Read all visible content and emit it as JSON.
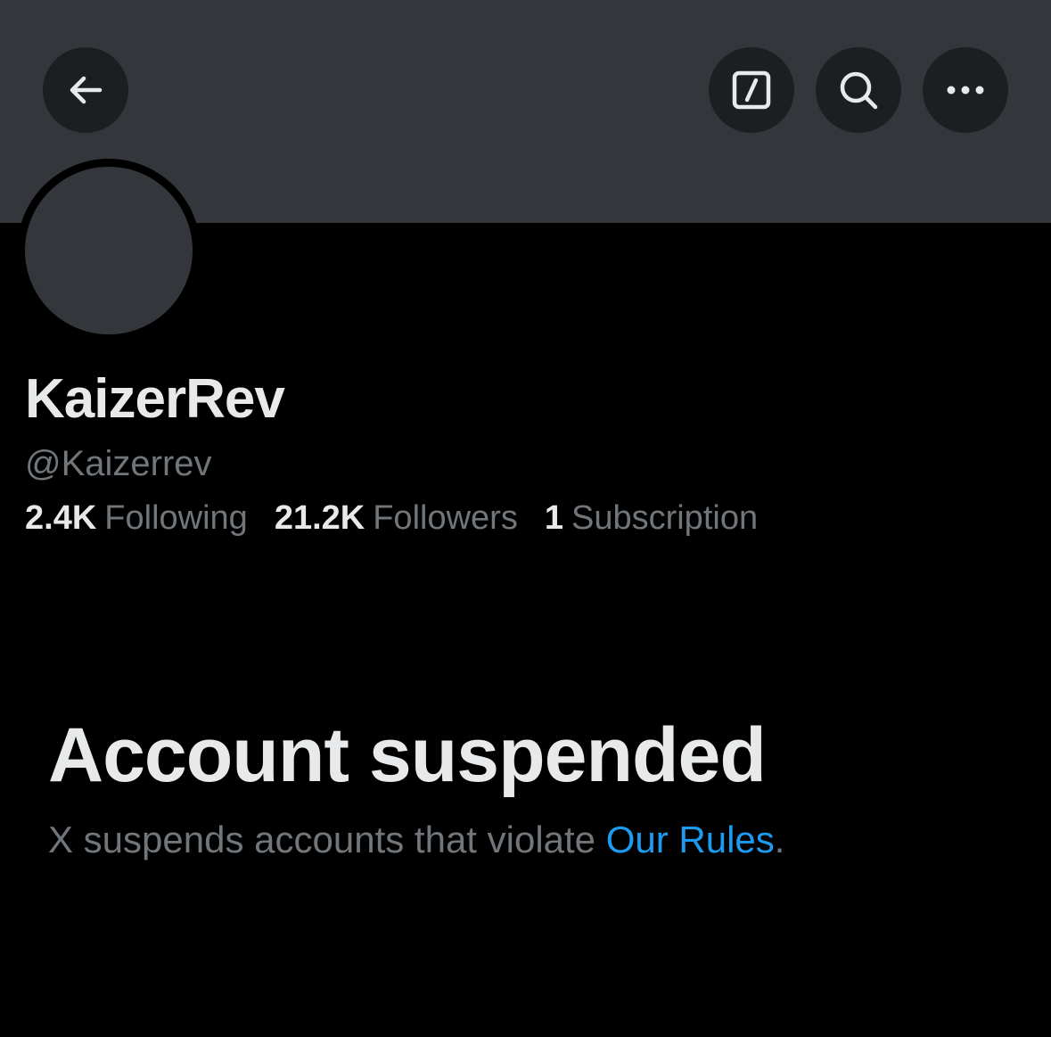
{
  "profile": {
    "display_name": "KaizerRev",
    "handle": "@Kaizerrev"
  },
  "stats": {
    "following": {
      "value": "2.4K",
      "label": "Following"
    },
    "followers": {
      "value": "21.2K",
      "label": "Followers"
    },
    "subscriptions": {
      "value": "1",
      "label": "Subscription"
    }
  },
  "suspension": {
    "title": "Account suspended",
    "message_prefix": "X suspends accounts that violate ",
    "link_text": "Our Rules",
    "message_suffix": "."
  },
  "icons": {
    "back": "arrow-left-icon",
    "compose": "compose-icon",
    "search": "search-icon",
    "more": "more-dots-icon"
  },
  "colors": {
    "background": "#000000",
    "banner": "#33363b",
    "button_bg": "#1c1e21",
    "primary_text": "#e7e9ea",
    "secondary_text": "#71767b",
    "link": "#1d9bf0"
  }
}
